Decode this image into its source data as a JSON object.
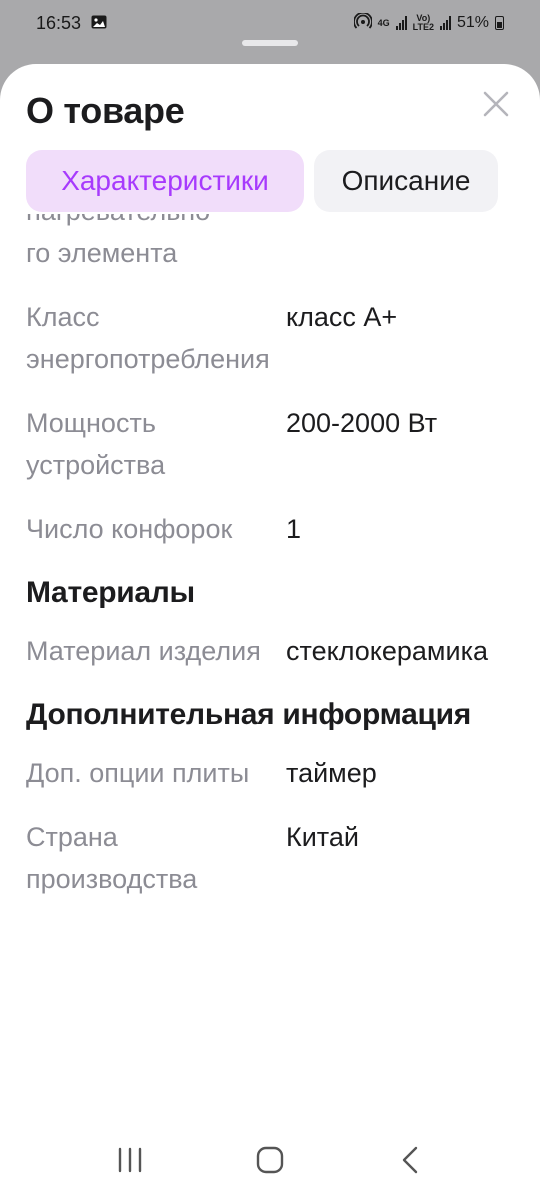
{
  "status_bar": {
    "time": "16:53",
    "network_top": "4G",
    "volte_top": "Vo)",
    "volte_bottom": "LTE2",
    "battery": "51%"
  },
  "sheet": {
    "title": "О товаре",
    "tabs": [
      {
        "label": "Характеристики",
        "active": true
      },
      {
        "label": "Описание",
        "active": false
      }
    ]
  },
  "content": {
    "partial_label_top": "нагревательно",
    "partial_label_bottom": "го элемента",
    "rows": [
      {
        "label": "Класс энергопотребления",
        "value": "класс A+"
      },
      {
        "label": "Мощность устройства",
        "value": "200-2000 Вт"
      },
      {
        "label": "Число конфорок",
        "value": "1"
      }
    ],
    "section_materials": "Материалы",
    "materials_rows": [
      {
        "label": "Материал изделия",
        "value": "стеклокерамика"
      }
    ],
    "section_extra": "Дополнительная информация",
    "extra_rows": [
      {
        "label": "Доп. опции плиты",
        "value": "таймер"
      },
      {
        "label": "Страна производства",
        "value": "Китай"
      }
    ]
  },
  "icons": {
    "close": "close-icon",
    "nav_recent": "recent-apps-icon",
    "nav_home": "home-icon",
    "nav_back": "back-icon"
  },
  "colors": {
    "accent": "#a73afd",
    "accent_bg": "#f1ddfa",
    "label_gray": "#8c8c94"
  }
}
